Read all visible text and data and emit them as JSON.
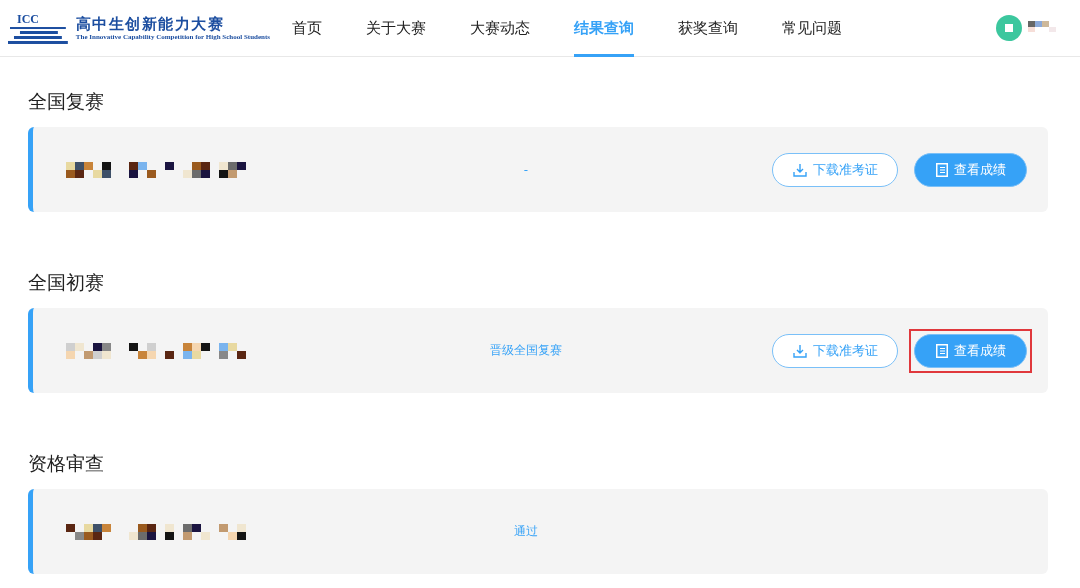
{
  "logo": {
    "mark": "ICC",
    "title": "高中生创新能力大赛",
    "subtitle": "The Innovative Capability Competition for High School Students"
  },
  "nav": [
    {
      "label": "首页",
      "selected": false
    },
    {
      "label": "关于大赛",
      "selected": false
    },
    {
      "label": "大赛动态",
      "selected": false
    },
    {
      "label": "结果查询",
      "selected": true
    },
    {
      "label": "获奖查询",
      "selected": false
    },
    {
      "label": "常见问题",
      "selected": false
    }
  ],
  "sections": [
    {
      "title": "全国复赛",
      "status": "-",
      "buttons": [
        {
          "kind": "download",
          "label": "下载准考证",
          "highlighted": false
        },
        {
          "kind": "view",
          "label": "查看成绩",
          "highlighted": false
        }
      ]
    },
    {
      "title": "全国初赛",
      "status": "晋级全国复赛",
      "buttons": [
        {
          "kind": "download",
          "label": "下载准考证",
          "highlighted": false
        },
        {
          "kind": "view",
          "label": "查看成绩",
          "highlighted": true
        }
      ]
    },
    {
      "title": "资格审查",
      "status": "通过"
    }
  ]
}
